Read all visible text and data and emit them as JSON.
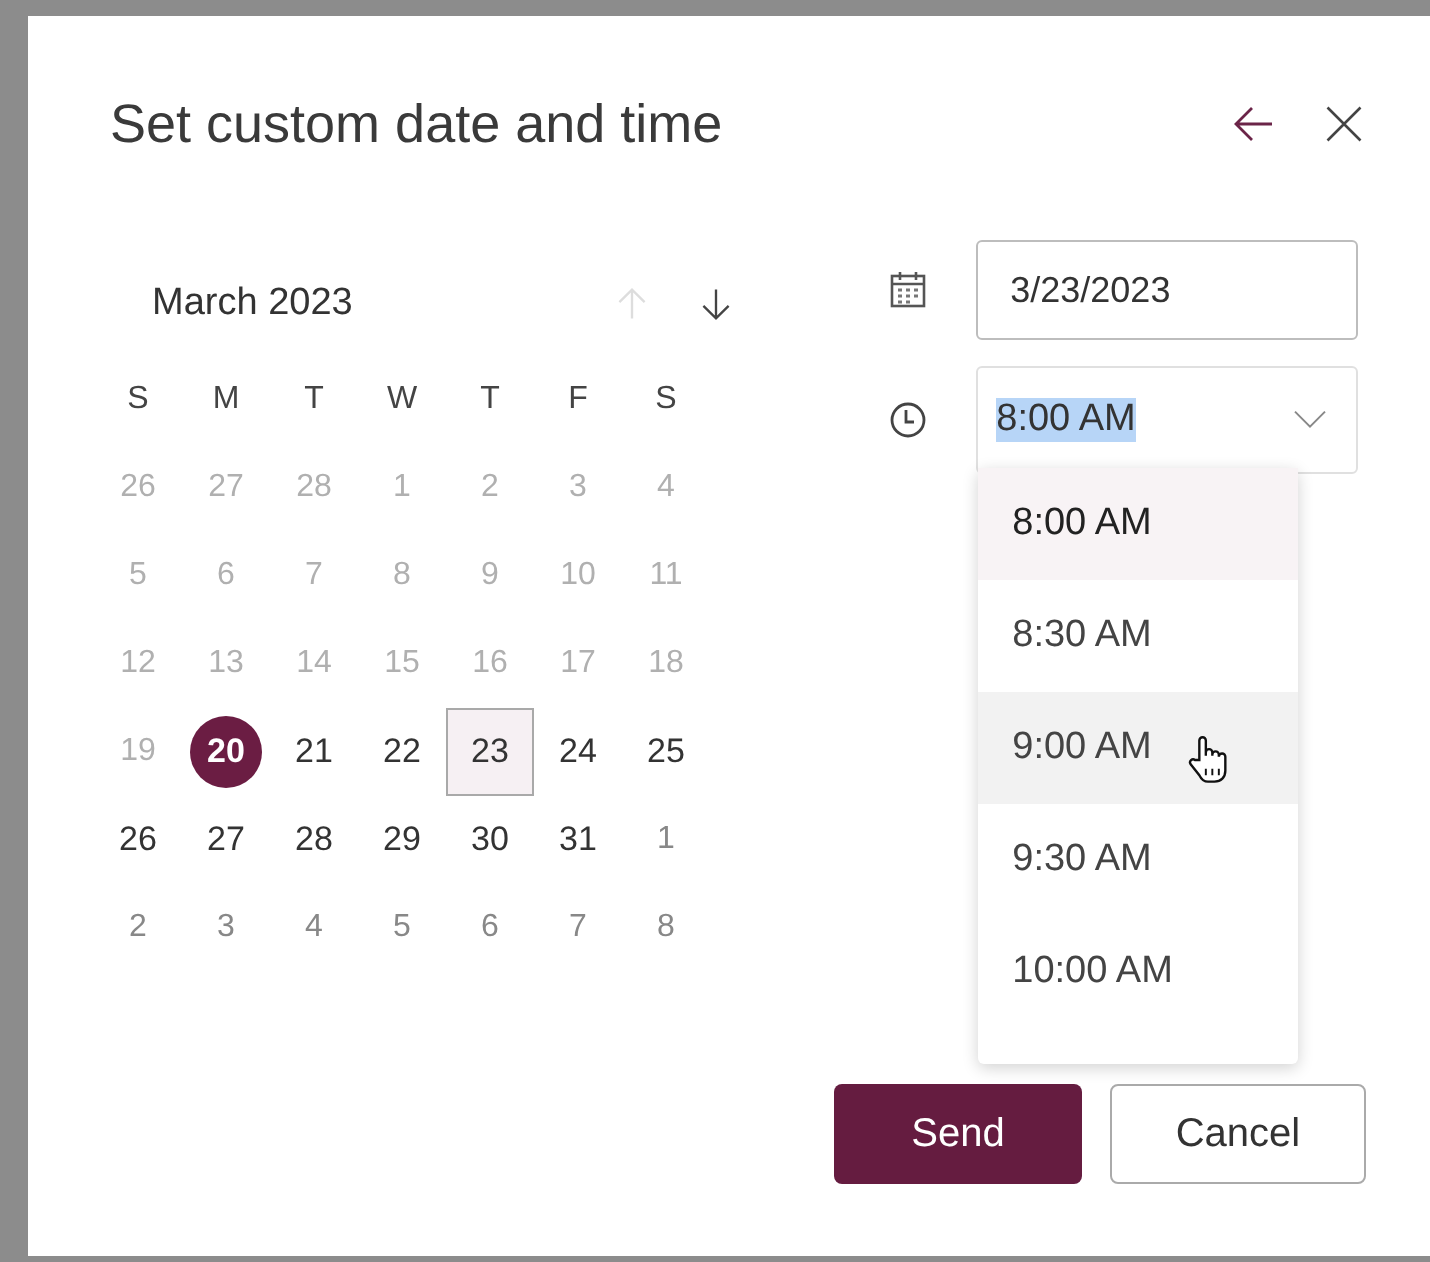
{
  "dialog": {
    "title": "Set custom date and time"
  },
  "calendar": {
    "month_label": "March 2023",
    "prev_disabled": true,
    "weekdays": [
      "S",
      "M",
      "T",
      "W",
      "T",
      "F",
      "S"
    ],
    "days": [
      {
        "label": "26",
        "kind": "past",
        "selected": false,
        "today": false
      },
      {
        "label": "27",
        "kind": "past",
        "selected": false,
        "today": false
      },
      {
        "label": "28",
        "kind": "past",
        "selected": false,
        "today": false
      },
      {
        "label": "1",
        "kind": "past",
        "selected": false,
        "today": false
      },
      {
        "label": "2",
        "kind": "past",
        "selected": false,
        "today": false
      },
      {
        "label": "3",
        "kind": "past",
        "selected": false,
        "today": false
      },
      {
        "label": "4",
        "kind": "past",
        "selected": false,
        "today": false
      },
      {
        "label": "5",
        "kind": "past",
        "selected": false,
        "today": false
      },
      {
        "label": "6",
        "kind": "past",
        "selected": false,
        "today": false
      },
      {
        "label": "7",
        "kind": "past",
        "selected": false,
        "today": false
      },
      {
        "label": "8",
        "kind": "past",
        "selected": false,
        "today": false
      },
      {
        "label": "9",
        "kind": "past",
        "selected": false,
        "today": false
      },
      {
        "label": "10",
        "kind": "past",
        "selected": false,
        "today": false
      },
      {
        "label": "11",
        "kind": "past",
        "selected": false,
        "today": false
      },
      {
        "label": "12",
        "kind": "past",
        "selected": false,
        "today": false
      },
      {
        "label": "13",
        "kind": "past",
        "selected": false,
        "today": false
      },
      {
        "label": "14",
        "kind": "past",
        "selected": false,
        "today": false
      },
      {
        "label": "15",
        "kind": "past",
        "selected": false,
        "today": false
      },
      {
        "label": "16",
        "kind": "past",
        "selected": false,
        "today": false
      },
      {
        "label": "17",
        "kind": "past",
        "selected": false,
        "today": false
      },
      {
        "label": "18",
        "kind": "past",
        "selected": false,
        "today": false
      },
      {
        "label": "19",
        "kind": "past",
        "selected": false,
        "today": false
      },
      {
        "label": "20",
        "kind": "current",
        "selected": false,
        "today": true
      },
      {
        "label": "21",
        "kind": "current",
        "selected": false,
        "today": false
      },
      {
        "label": "22",
        "kind": "current",
        "selected": false,
        "today": false
      },
      {
        "label": "23",
        "kind": "current",
        "selected": true,
        "today": false
      },
      {
        "label": "24",
        "kind": "current",
        "selected": false,
        "today": false
      },
      {
        "label": "25",
        "kind": "current",
        "selected": false,
        "today": false
      },
      {
        "label": "26",
        "kind": "current",
        "selected": false,
        "today": false
      },
      {
        "label": "27",
        "kind": "current",
        "selected": false,
        "today": false
      },
      {
        "label": "28",
        "kind": "current",
        "selected": false,
        "today": false
      },
      {
        "label": "29",
        "kind": "current",
        "selected": false,
        "today": false
      },
      {
        "label": "30",
        "kind": "current",
        "selected": false,
        "today": false
      },
      {
        "label": "31",
        "kind": "current",
        "selected": false,
        "today": false
      },
      {
        "label": "1",
        "kind": "other",
        "selected": false,
        "today": false
      },
      {
        "label": "2",
        "kind": "other",
        "selected": false,
        "today": false
      },
      {
        "label": "3",
        "kind": "other",
        "selected": false,
        "today": false
      },
      {
        "label": "4",
        "kind": "other",
        "selected": false,
        "today": false
      },
      {
        "label": "5",
        "kind": "other",
        "selected": false,
        "today": false
      },
      {
        "label": "6",
        "kind": "other",
        "selected": false,
        "today": false
      },
      {
        "label": "7",
        "kind": "other",
        "selected": false,
        "today": false
      },
      {
        "label": "8",
        "kind": "other",
        "selected": false,
        "today": false
      }
    ]
  },
  "date_field": {
    "value": "3/23/2023"
  },
  "time_field": {
    "value": "8:00 AM",
    "text_selected": true
  },
  "time_options": [
    {
      "label": "8:00 AM",
      "selected": true,
      "hovered": false
    },
    {
      "label": "8:30 AM",
      "selected": false,
      "hovered": false
    },
    {
      "label": "9:00 AM",
      "selected": false,
      "hovered": true
    },
    {
      "label": "9:30 AM",
      "selected": false,
      "hovered": false
    },
    {
      "label": "10:00 AM",
      "selected": false,
      "hovered": false
    }
  ],
  "buttons": [
    {
      "label": "Send",
      "kind": "primary"
    },
    {
      "label": "Cancel",
      "kind": "secondary"
    }
  ]
}
